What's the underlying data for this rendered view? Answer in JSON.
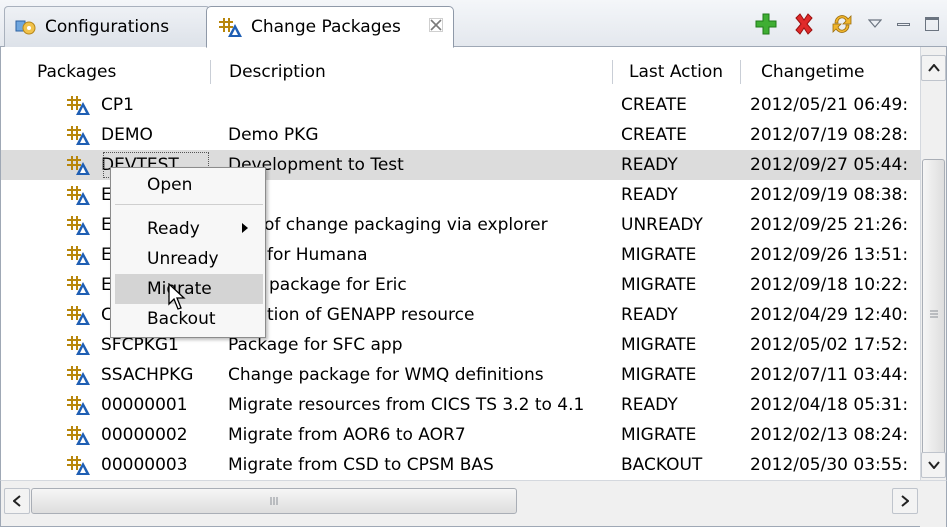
{
  "tabs": {
    "configurations_label": "Configurations",
    "change_packages_label": "Change Packages"
  },
  "table": {
    "columns": {
      "packages": "Packages",
      "description": "Description",
      "last_action": "Last Action",
      "changetime": "Changetime"
    },
    "rows": [
      {
        "package": "CP1",
        "description": "",
        "last_action": "CREATE",
        "changetime": "2012/05/21 06:49:"
      },
      {
        "package": "DEMO",
        "description": "Demo PKG",
        "last_action": "CREATE",
        "changetime": "2012/07/19 08:28:"
      },
      {
        "package": "DEVTEST",
        "description": "Development to Test",
        "last_action": "READY",
        "changetime": "2012/09/27 05:44:"
      },
      {
        "package": "E",
        "description": "",
        "last_action": "READY",
        "changetime": "2012/09/19 08:38:"
      },
      {
        "package": "E",
        "description": "of change packaging via explorer",
        "last_action": "UNREADY",
        "changetime": "2012/09/25 21:26:"
      },
      {
        "package": "E",
        "description": "for Humana",
        "last_action": "MIGRATE",
        "changetime": "2012/09/26 13:51:"
      },
      {
        "package": "E",
        "description": "package for Eric",
        "last_action": "MIGRATE",
        "changetime": "2012/09/18 10:22:"
      },
      {
        "package": "C",
        "description": "tion of GENAPP resource",
        "last_action": "READY",
        "changetime": "2012/04/29 12:40:"
      },
      {
        "package": "SFCPKG1",
        "description": "Package for SFC app",
        "last_action": "MIGRATE",
        "changetime": "2012/05/02 17:52:"
      },
      {
        "package": "SSACHPKG",
        "description": "Change package for WMQ definitions",
        "last_action": "MIGRATE",
        "changetime": "2012/07/11 03:44:"
      },
      {
        "package": "00000001",
        "description": "Migrate resources from CICS TS 3.2 to 4.1",
        "last_action": "READY",
        "changetime": "2012/04/18 05:31:"
      },
      {
        "package": "00000002",
        "description": "Migrate from AOR6 to AOR7",
        "last_action": "MIGRATE",
        "changetime": "2012/02/13 08:24:"
      },
      {
        "package": "00000003",
        "description": "Migrate from CSD to CPSM BAS",
        "last_action": "BACKOUT",
        "changetime": "2012/05/30 03:55:"
      }
    ],
    "selected_row": 2
  },
  "context_menu": {
    "open": "Open",
    "ready": "Ready",
    "unready": "Unready",
    "migrate": "Migrate",
    "backout": "Backout"
  },
  "toolbar_icons": [
    "add-icon",
    "delete-icon",
    "sync-icon",
    "view-menu-icon",
    "minimize-icon",
    "maximize-icon"
  ],
  "colors": {
    "selected_row": "#dcdcdc",
    "menu_hover": "#d4d4d4",
    "add": "#36a32c",
    "delete": "#d52020",
    "package_icon_grid": "#b8860b",
    "package_icon_triangle": "#1f5fb4"
  }
}
